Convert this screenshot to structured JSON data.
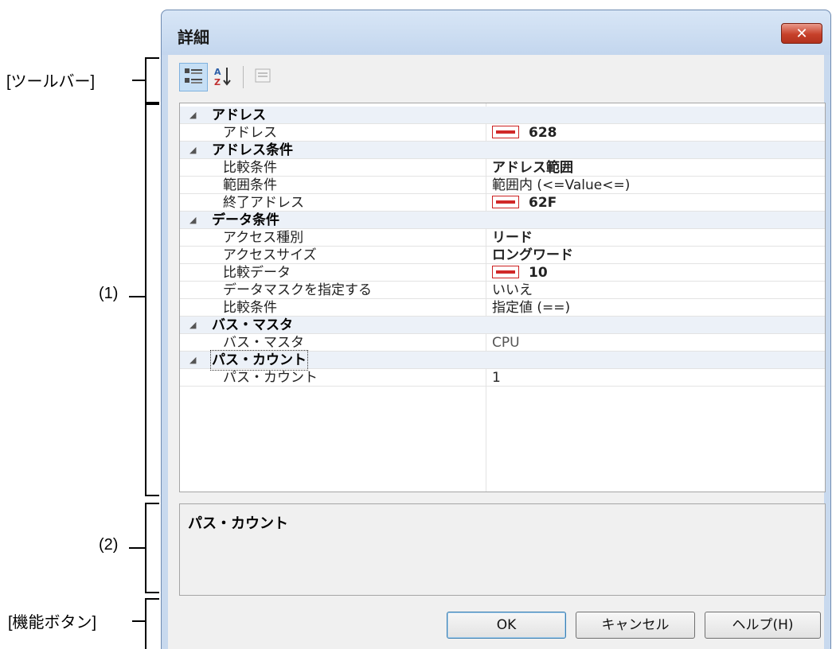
{
  "callouts": {
    "toolbar": "[ツールバー]",
    "area1": "(1)",
    "area2": "(2)",
    "func_buttons": "[機能ボタン]"
  },
  "dialog": {
    "title": "詳細",
    "close_glyph": "✕",
    "toolbar": {
      "buttons": [
        {
          "icon": "categorized-view-icon",
          "active": true
        },
        {
          "icon": "sort-az-icon",
          "active": false
        },
        {
          "icon": "property-pages-icon",
          "active": false
        }
      ]
    },
    "properties": [
      {
        "category": "アドレス",
        "items": [
          {
            "name": "アドレス",
            "value": "628",
            "hex": true,
            "bold": true
          }
        ]
      },
      {
        "category": "アドレス条件",
        "items": [
          {
            "name": "比較条件",
            "value": "アドレス範囲",
            "bold": true
          },
          {
            "name": "範囲条件",
            "value": "範囲内 (<=Value<=)"
          },
          {
            "name": "終了アドレス",
            "value": "62F",
            "hex": true,
            "bold": true
          }
        ]
      },
      {
        "category": "データ条件",
        "items": [
          {
            "name": "アクセス種別",
            "value": "リード",
            "bold": true
          },
          {
            "name": "アクセスサイズ",
            "value": "ロングワード",
            "bold": true
          },
          {
            "name": "比較データ",
            "value": "10",
            "hex": true,
            "bold": true
          },
          {
            "name": "データマスクを指定する",
            "value": "いいえ"
          },
          {
            "name": "比較条件",
            "value": "指定値 (==)"
          }
        ]
      },
      {
        "category": "バス・マスタ",
        "items": [
          {
            "name": "バス・マスタ",
            "value": "CPU",
            "muted": true
          }
        ]
      },
      {
        "category": "パス・カウント",
        "focused": true,
        "items": [
          {
            "name": "パス・カウント",
            "value": "1"
          }
        ]
      }
    ],
    "description": {
      "title": "パス・カウント"
    },
    "buttons": {
      "ok": "OK",
      "cancel": "キャンセル",
      "help": "ヘルプ(H)"
    }
  }
}
